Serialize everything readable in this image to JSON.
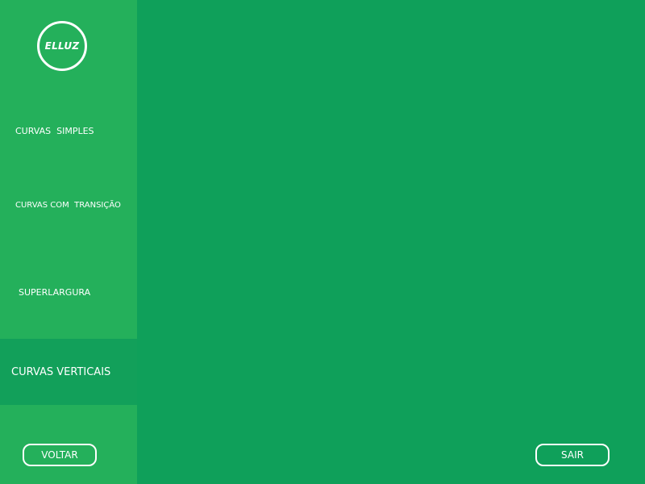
{
  "logo": {
    "text": "ELLUZ"
  },
  "sidebar": {
    "items": [
      {
        "label": "CURVAS  SIMPLES"
      },
      {
        "label": "CURVAS COM  TRANSIÇÃO"
      },
      {
        "label": "SUPERLARGURA"
      },
      {
        "label": "CURVAS VERTICAIS",
        "active": true
      }
    ]
  },
  "buttons": {
    "back_label": "VOLTAR",
    "exit_label": "SAIR"
  },
  "colors": {
    "main_background": "#0fa05a",
    "sidebar_background": "#24b05b",
    "active_item_background": "#12a05a",
    "text": "#ffffff"
  }
}
